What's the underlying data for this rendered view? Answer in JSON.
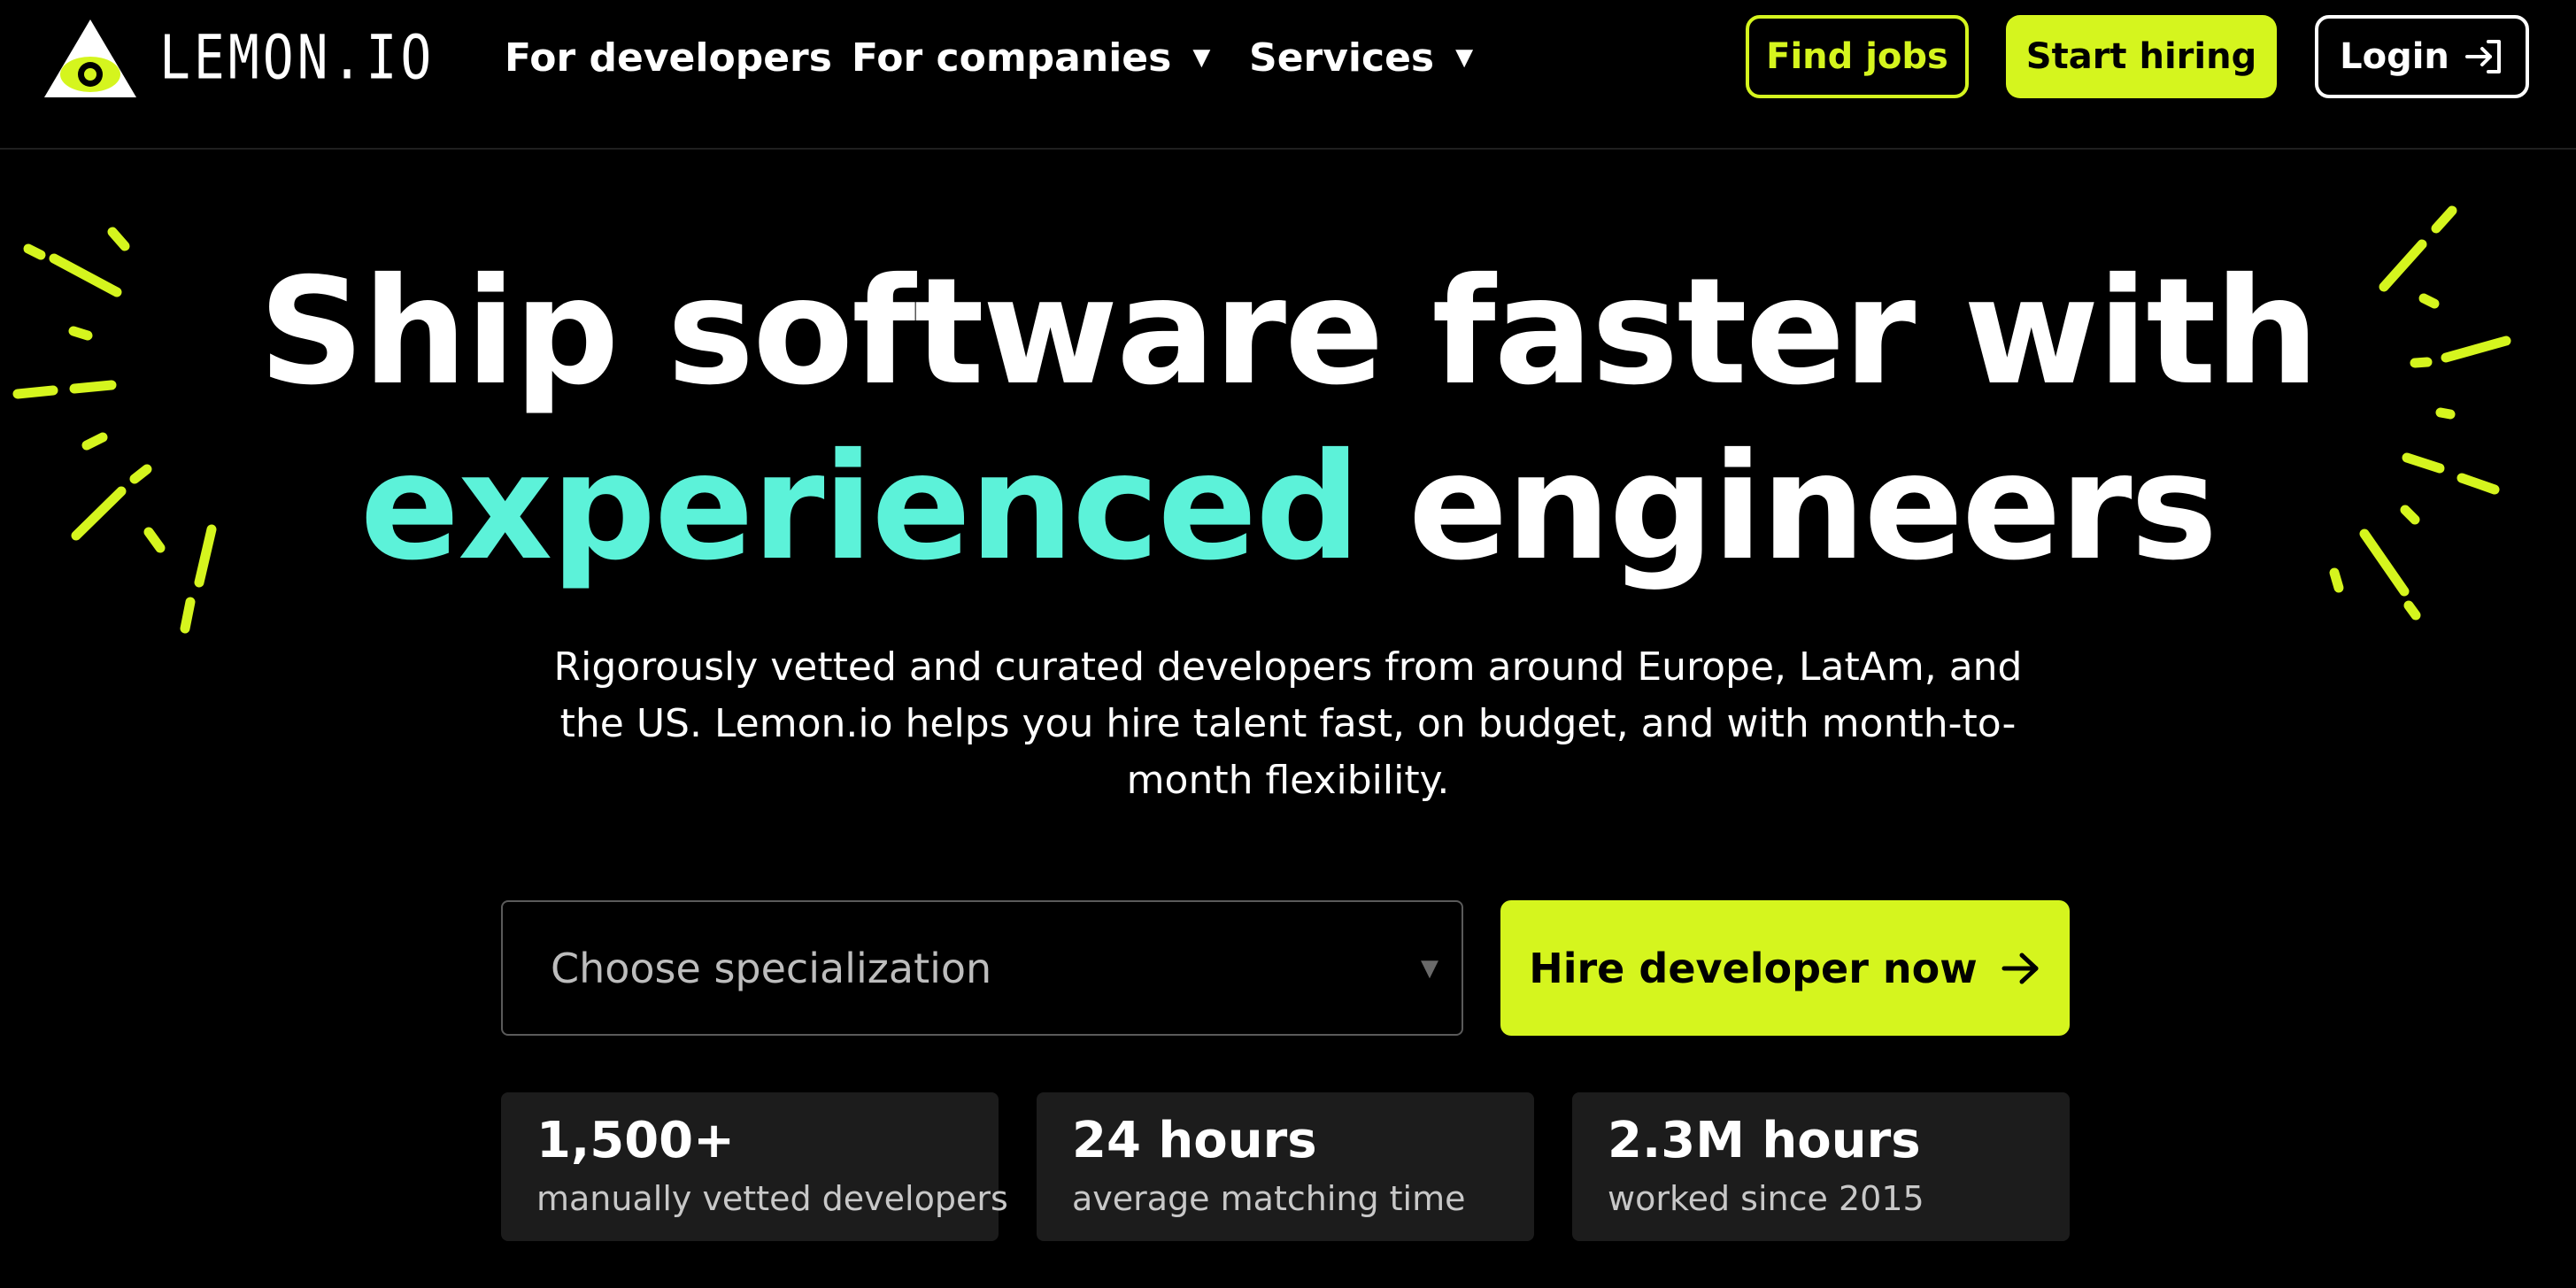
{
  "brand": {
    "name": "LEMON.IO",
    "accent_color": "#d5f51e",
    "highlight_color": "#5cf2d9",
    "logo_icon": "eye-in-triangle-icon"
  },
  "nav": {
    "items": [
      {
        "label": "For developers",
        "has_dropdown": false
      },
      {
        "label": "For companies",
        "has_dropdown": true,
        "caret": "▼"
      },
      {
        "label": "Services",
        "has_dropdown": true,
        "caret": "▼"
      }
    ]
  },
  "header_actions": {
    "find_jobs": "Find jobs",
    "start_hiring": "Start hiring",
    "login": "Login",
    "login_icon": "login-icon"
  },
  "hero": {
    "line1": "Ship software faster with",
    "line2_accent": "experienced",
    "line2_rest": "engineers",
    "subtitle": "Rigorously vetted and curated developers from around Europe, LatAm, and the US. Lemon.io helps you hire talent fast, on budget, and with month-to-month flexibility."
  },
  "search": {
    "select_placeholder": "Choose specialization",
    "select_caret": "▼",
    "hire_button": "Hire developer now",
    "hire_icon": "arrow-right-icon"
  },
  "stats": [
    {
      "value": "1,500+",
      "label": "manually vetted developers"
    },
    {
      "value": "24 hours",
      "label": "average matching time"
    },
    {
      "value": "2.3M hours",
      "label": "worked since 2015"
    }
  ]
}
